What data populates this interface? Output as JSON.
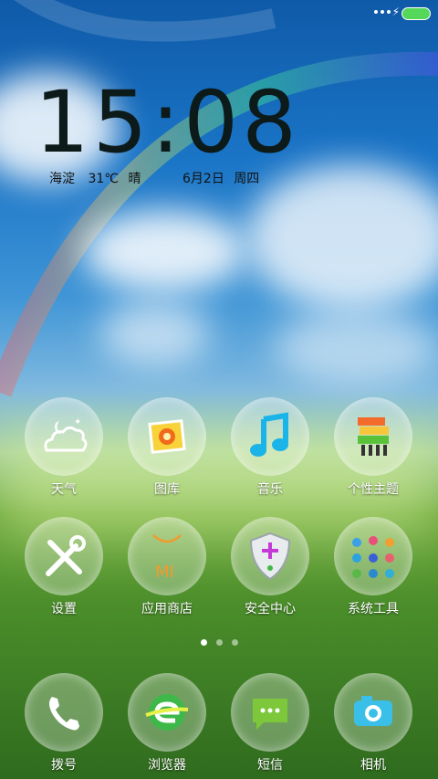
{
  "status_bar": {
    "battery_color": "#55d85a"
  },
  "clock": {
    "time": "15:08"
  },
  "weather": {
    "location": "海淀",
    "temperature": "31℃",
    "condition": "晴"
  },
  "date": {
    "date": "6月2日",
    "weekday": "周四"
  },
  "apps": [
    {
      "label": "天气",
      "icon": "weather-icon"
    },
    {
      "label": "图库",
      "icon": "gallery-icon"
    },
    {
      "label": "音乐",
      "icon": "music-icon"
    },
    {
      "label": "个性主题",
      "icon": "theme-icon"
    },
    {
      "label": "设置",
      "icon": "settings-icon"
    },
    {
      "label": "应用商店",
      "icon": "app-store-icon"
    },
    {
      "label": "安全中心",
      "icon": "security-icon"
    },
    {
      "label": "系统工具",
      "icon": "system-tools-icon"
    }
  ],
  "dock": [
    {
      "label": "拨号",
      "icon": "phone-icon"
    },
    {
      "label": "浏览器",
      "icon": "browser-icon"
    },
    {
      "label": "短信",
      "icon": "sms-icon"
    },
    {
      "label": "相机",
      "icon": "camera-icon"
    }
  ],
  "app_store_logo_text": "MI",
  "pager": {
    "pages": 3,
    "current": 1
  }
}
